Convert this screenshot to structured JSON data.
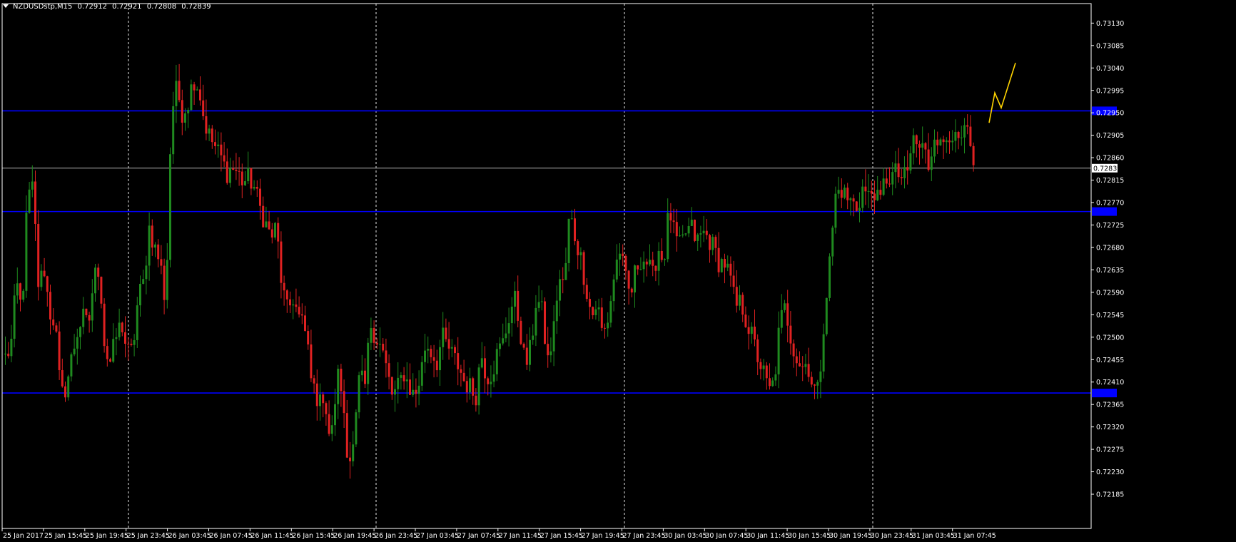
{
  "window": {
    "symbol": "NZDUSDstp,M15",
    "open": "0.72912",
    "high": "0.72921",
    "low": "0.72808",
    "close": "0.72839"
  },
  "colors": {
    "background": "#000000",
    "axis": "#ffffff",
    "bull_candle": "#1f8a1f",
    "bear_candle": "#e02121",
    "level_line": "#0000ff",
    "current_price_line": "#b0b0b0",
    "zigzag_projection": "#ffd400",
    "period_separator": "#ffffff"
  },
  "chart_data": {
    "type": "candlestick",
    "symbol": "NZDUSDstp",
    "timeframe": "M15",
    "ylim": [
      0.72185,
      0.73152
    ],
    "y_ticks": [
      "0.73130",
      "0.73085",
      "0.73040",
      "0.72995",
      "0.72950",
      "0.72905",
      "0.72860",
      "0.72815",
      "0.72770",
      "0.72725",
      "0.72680",
      "0.72635",
      "0.72590",
      "0.72545",
      "0.72500",
      "0.72455",
      "0.72410",
      "0.72365",
      "0.72320",
      "0.72275",
      "0.72230",
      "0.72185"
    ],
    "x_ticks": [
      "25 Jan 2017",
      "25 Jan 15:45",
      "25 Jan 19:45",
      "25 Jan 23:45",
      "26 Jan 03:45",
      "26 Jan 07:45",
      "26 Jan 11:45",
      "26 Jan 15:45",
      "26 Jan 19:45",
      "26 Jan 23:45",
      "27 Jan 03:45",
      "27 Jan 07:45",
      "27 Jan 11:45",
      "27 Jan 15:45",
      "27 Jan 19:45",
      "27 Jan 23:45",
      "30 Jan 03:45",
      "30 Jan 07:45",
      "30 Jan 11:45",
      "30 Jan 15:45",
      "30 Jan 19:45",
      "30 Jan 23:45",
      "31 Jan 03:45",
      "31 Jan 07:45"
    ],
    "current_price": "0.72839",
    "horizontal_levels": [
      0.72954,
      0.72752,
      0.72388
    ],
    "close_path": [
      [
        0.7246,
        0.7248
      ],
      [
        0.7261,
        0.7255
      ],
      [
        0.7278,
        0.728
      ],
      [
        0.726,
        0.7264
      ],
      [
        0.7255,
        0.7253
      ],
      [
        0.7238,
        0.724
      ],
      [
        0.7246,
        0.7251
      ],
      [
        0.7254,
        0.7252
      ],
      [
        0.7262,
        0.7264
      ],
      [
        0.7247,
        0.7245
      ],
      [
        0.725,
        0.7253
      ],
      [
        0.7247,
        0.7247
      ],
      [
        0.7258,
        0.7261
      ],
      [
        0.7272,
        0.7268
      ],
      [
        0.7265,
        0.7256
      ],
      [
        0.7295,
        0.73
      ],
      [
        0.7295,
        0.7297
      ],
      [
        0.7302,
        0.73
      ],
      [
        0.7293,
        0.729
      ],
      [
        0.7288,
        0.7286
      ],
      [
        0.7283,
        0.7284
      ],
      [
        0.7283,
        0.7281
      ],
      [
        0.7282,
        0.728
      ],
      [
        0.7276,
        0.7273
      ],
      [
        0.727,
        0.7272
      ],
      [
        0.726,
        0.7255
      ],
      [
        0.7258,
        0.7254
      ],
      [
        0.7252,
        0.7246
      ],
      [
        0.7237,
        0.724
      ],
      [
        0.7233,
        0.723
      ],
      [
        0.7243,
        0.7238
      ],
      [
        0.7225,
        0.7228
      ],
      [
        0.7242,
        0.724
      ],
      [
        0.7253,
        0.725
      ],
      [
        0.7248,
        0.7243
      ],
      [
        0.7238,
        0.724
      ],
      [
        0.7243,
        0.724
      ],
      [
        0.7238,
        0.7242
      ],
      [
        0.7249,
        0.7247
      ],
      [
        0.7245,
        0.725
      ],
      [
        0.7248,
        0.7246
      ],
      [
        0.7244,
        0.7241
      ],
      [
        0.724,
        0.7238
      ],
      [
        0.7247,
        0.7242
      ],
      [
        0.7243,
        0.7247
      ],
      [
        0.7249,
        0.7254
      ],
      [
        0.7258,
        0.7252
      ],
      [
        0.7244,
        0.7248
      ],
      [
        0.7258,
        0.7255
      ],
      [
        0.7245,
        0.725
      ],
      [
        0.7262,
        0.726
      ],
      [
        0.7275,
        0.727
      ],
      [
        0.7266,
        0.726
      ],
      [
        0.7254,
        0.7257
      ],
      [
        0.725,
        0.7254
      ],
      [
        0.7262,
        0.7268
      ],
      [
        0.7262,
        0.7258
      ],
      [
        0.7264,
        0.7266
      ],
      [
        0.7265,
        0.7262
      ],
      [
        0.7268,
        0.7265
      ],
      [
        0.7276,
        0.727
      ],
      [
        0.7268,
        0.7271
      ],
      [
        0.7272,
        0.7269
      ],
      [
        0.7271,
        0.727
      ],
      [
        0.7268,
        0.7265
      ],
      [
        0.7265,
        0.7262
      ],
      [
        0.7256,
        0.7257
      ],
      [
        0.7253,
        0.725
      ],
      [
        0.7246,
        0.7243
      ],
      [
        0.7239,
        0.7241
      ],
      [
        0.7253,
        0.7256
      ],
      [
        0.725,
        0.7246
      ],
      [
        0.7244,
        0.7245
      ],
      [
        0.724,
        0.7239
      ],
      [
        0.7254,
        0.7265
      ],
      [
        0.7278,
        0.728
      ],
      [
        0.7278,
        0.7277
      ],
      [
        0.7276,
        0.728
      ],
      [
        0.7278,
        0.728
      ],
      [
        0.7276,
        0.7282
      ],
      [
        0.7282,
        0.7283
      ],
      [
        0.7282,
        0.7282
      ],
      [
        0.729,
        0.7288
      ],
      [
        0.7288,
        0.7284
      ],
      [
        0.7292,
        0.7288
      ],
      [
        0.729,
        0.7292
      ],
      [
        0.7288,
        0.729
      ],
      [
        0.7291,
        0.7283
      ]
    ],
    "zigzag_projection": [
      [
        0.7293
      ],
      [
        0.7299
      ],
      [
        0.7296
      ],
      [
        0.7305
      ]
    ]
  }
}
